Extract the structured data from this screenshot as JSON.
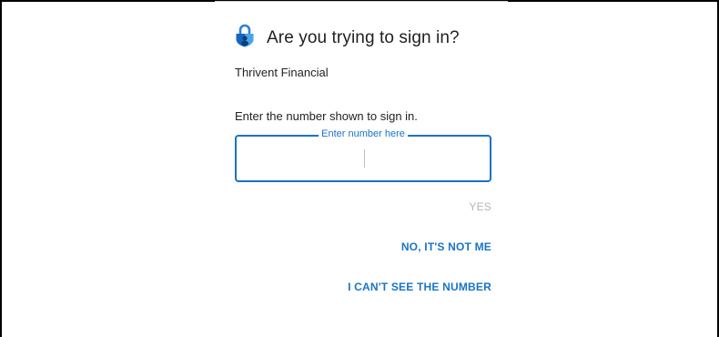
{
  "dialog": {
    "title": "Are you trying to sign in?",
    "app_icon": "authenticator-lock-icon",
    "account_name": "Thrivent Financial",
    "instruction": "Enter the number shown to sign in.",
    "number_field": {
      "label": "Enter number here",
      "value": ""
    },
    "buttons": {
      "yes": "YES",
      "not_me": "NO, IT'S NOT ME",
      "cant_see": "I CAN'T SEE THE NUMBER"
    }
  },
  "colors": {
    "accent": "#1a73c8",
    "disabled": "#b5b5b5",
    "icon_blue": "#1565c0",
    "icon_light": "#4aa3e8"
  }
}
